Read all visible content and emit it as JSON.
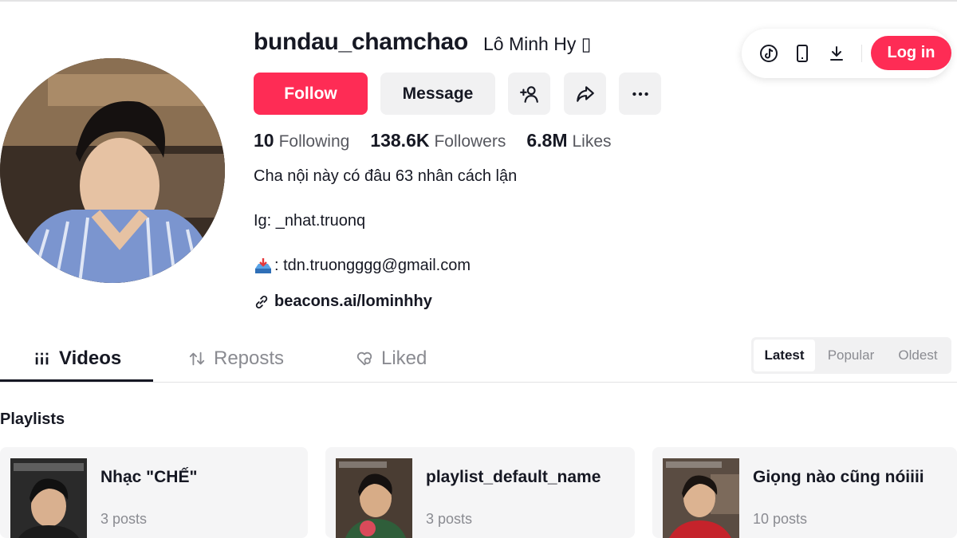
{
  "profile": {
    "username": "bundau_chamchao",
    "nickname": "Lô Minh Hy",
    "nickname_badge": "▯",
    "follow_label": "Follow",
    "message_label": "Message",
    "icons": [
      "add-friend-icon",
      "share-icon",
      "more-icon"
    ]
  },
  "stats": [
    {
      "value": "10",
      "label": "Following"
    },
    {
      "value": "138.6K",
      "label": "Followers"
    },
    {
      "value": "6.8M",
      "label": "Likes"
    }
  ],
  "bio": {
    "line1": "Cha nội này có đâu 63 nhân cách lận",
    "line2": "Ig: _nhat.truonq",
    "line3_emoji": "📥",
    "line3": ": tdn.truongggg@gmail.com",
    "link": "beacons.ai/lominhhy"
  },
  "top_panel": {
    "icons": [
      "tiktok-icon",
      "mobile-icon",
      "download-icon"
    ],
    "login_label": "Log in"
  },
  "tabs": [
    {
      "label": "Videos",
      "icon": "grid-icon",
      "active": true
    },
    {
      "label": "Reposts",
      "icon": "repost-icon",
      "active": false
    },
    {
      "label": "Liked",
      "icon": "liked-heart-icon",
      "active": false
    }
  ],
  "sort": {
    "options": [
      "Latest",
      "Popular",
      "Oldest"
    ],
    "selected": "Latest"
  },
  "playlists": {
    "title": "Playlists",
    "items": [
      {
        "name": "Nhạc \"CHẾ\"",
        "count": "3 posts"
      },
      {
        "name": "playlist_default_name",
        "count": "3 posts"
      },
      {
        "name": "Giọng nào cũng nóiiii",
        "count": "10 posts"
      }
    ]
  },
  "colors": {
    "accent": "#fe2c55",
    "text": "#161823",
    "muted": "#8a8b91",
    "button_bg": "#f1f1f2"
  }
}
